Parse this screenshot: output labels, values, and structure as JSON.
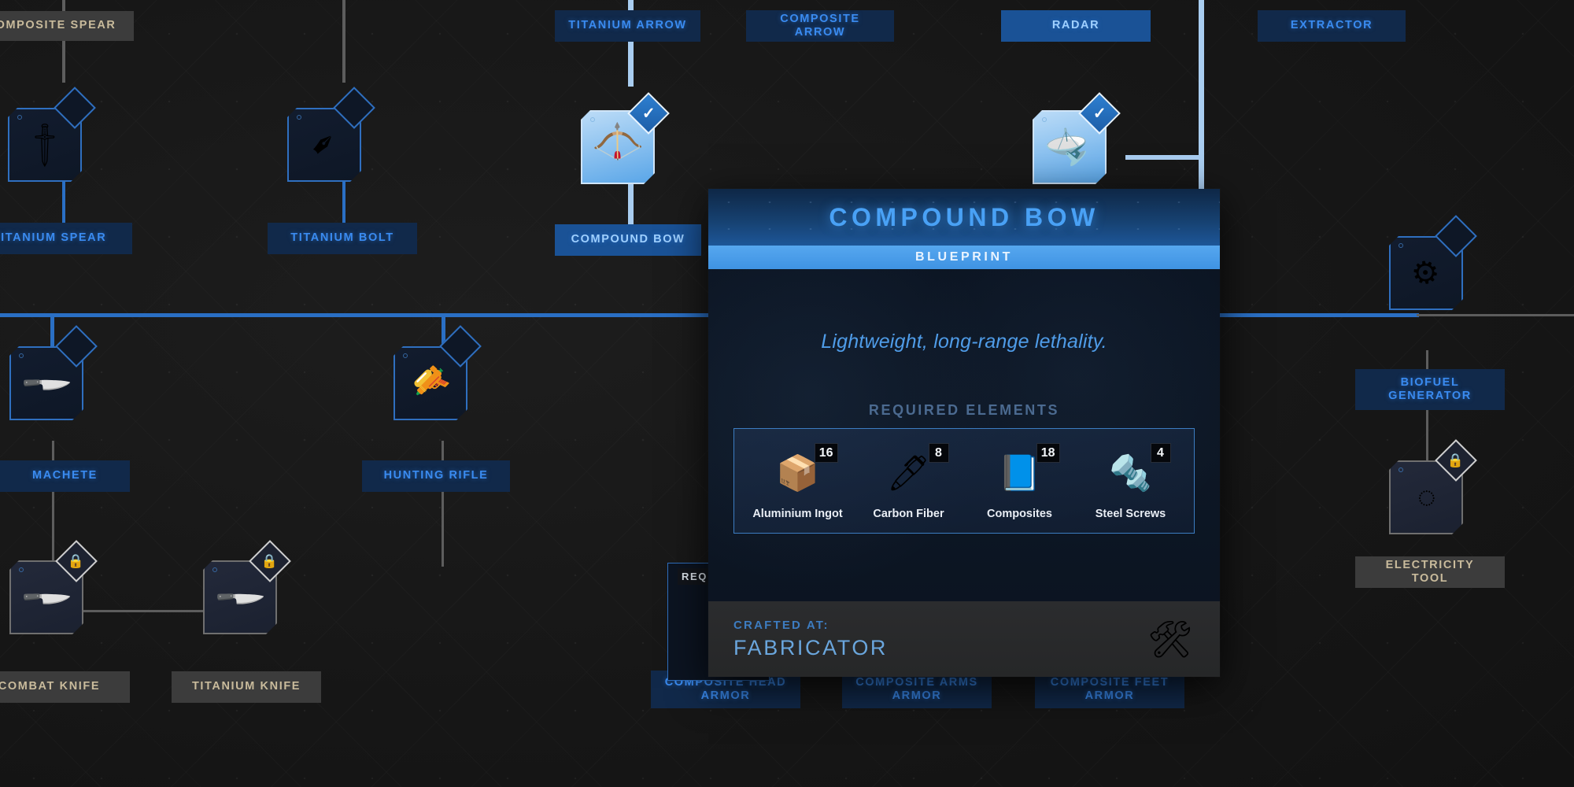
{
  "background": {
    "accent_blue": "#2f6fbf",
    "locked_grey": "#6f6f6f",
    "panel_bg": "#0d1725"
  },
  "tree": {
    "nodes": [
      {
        "id": "composite-spear",
        "label": "COMPOSITE SPEAR",
        "state": "locked",
        "glyph": ""
      },
      {
        "id": "titanium-arrow",
        "label": "TITANIUM ARROW",
        "state": "unlocked",
        "glyph": ""
      },
      {
        "id": "composite-arrow",
        "label": "COMPOSITE ARROW",
        "state": "unlocked",
        "glyph": ""
      },
      {
        "id": "radar",
        "label": "RADAR",
        "state": "selected",
        "glyph": "📡"
      },
      {
        "id": "extractor",
        "label": "EXTRACTOR",
        "state": "unlocked",
        "glyph": ""
      },
      {
        "id": "titanium-spear",
        "label": "TITANIUM SPEAR",
        "state": "unlocked",
        "glyph": "🗡"
      },
      {
        "id": "titanium-bolt",
        "label": "TITANIUM BOLT",
        "state": "unlocked",
        "glyph": "✒"
      },
      {
        "id": "compound-bow",
        "label": "COMPOUND BOW",
        "state": "selected",
        "glyph": "🏹"
      },
      {
        "id": "machete",
        "label": "MACHETE",
        "state": "unlocked",
        "glyph": "🔪"
      },
      {
        "id": "hunting-rifle",
        "label": "HUNTING RIFLE",
        "state": "unlocked",
        "glyph": "🔫"
      },
      {
        "id": "combat-knife",
        "label": "COMBAT KNIFE",
        "state": "locked",
        "glyph": "🔪"
      },
      {
        "id": "titanium-knife",
        "label": "TITANIUM KNIFE",
        "state": "locked",
        "glyph": "🔪"
      },
      {
        "id": "biofuel-generator",
        "label": "BIOFUEL\nGENERATOR",
        "state": "unlocked",
        "glyph": "⚙"
      },
      {
        "id": "electricity-tool",
        "label": "ELECTRICITY TOOL",
        "state": "locked",
        "glyph": "◌"
      },
      {
        "id": "composite-head-armor",
        "label": "COMPOSITE HEAD\nARMOR",
        "state": "unlocked",
        "glyph": ""
      },
      {
        "id": "composite-arms-armor",
        "label": "COMPOSITE ARMS\nARMOR",
        "state": "unlocked",
        "glyph": ""
      },
      {
        "id": "composite-feet-armor",
        "label": "COMPOSITE FEET\nARMOR",
        "state": "unlocked",
        "glyph": ""
      }
    ]
  },
  "panel": {
    "title": "COMPOUND BOW",
    "subtitle": "BLUEPRINT",
    "description": "Lightweight, long-range lethality.",
    "required_title": "REQUIRED ELEMENTS",
    "ingredients": [
      {
        "name": "Aluminium Ingot",
        "qty": "16",
        "glyph": "📦"
      },
      {
        "name": "Carbon Fiber",
        "qty": "8",
        "glyph": "🖊"
      },
      {
        "name": "Composites",
        "qty": "18",
        "glyph": "📘"
      },
      {
        "name": "Steel Screws",
        "qty": "4",
        "glyph": "🔩"
      }
    ],
    "crafted_at_label": "CRAFTED AT:",
    "crafted_at_value": "FABRICATOR",
    "crafted_at_icon": "🛠"
  },
  "mini_tooltip": {
    "title": "REQ"
  }
}
